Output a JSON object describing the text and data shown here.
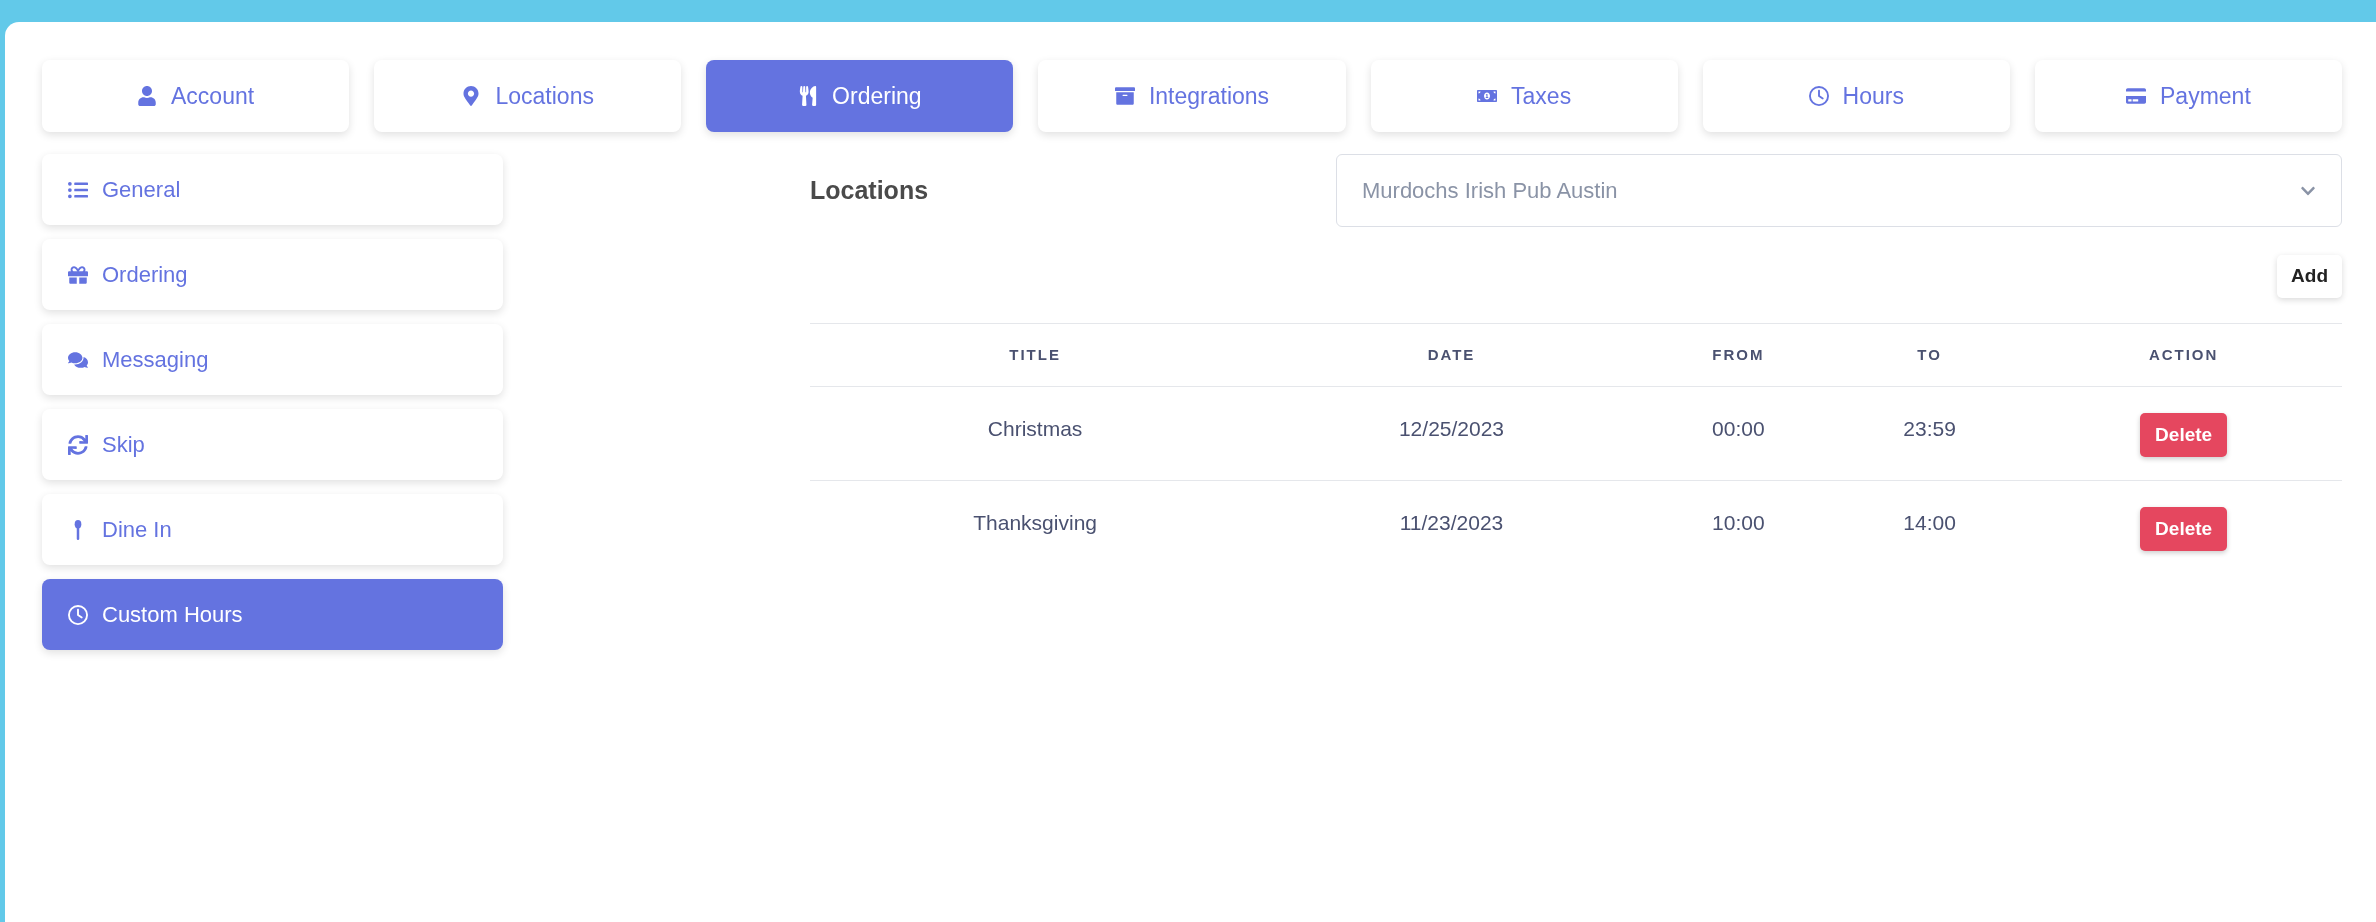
{
  "tabs": [
    {
      "label": "Account",
      "selected": false
    },
    {
      "label": "Locations",
      "selected": false
    },
    {
      "label": "Ordering",
      "selected": true
    },
    {
      "label": "Integrations",
      "selected": false
    },
    {
      "label": "Taxes",
      "selected": false
    },
    {
      "label": "Hours",
      "selected": false
    },
    {
      "label": "Payment",
      "selected": false
    }
  ],
  "sidebar": {
    "items": [
      {
        "label": "General",
        "selected": false
      },
      {
        "label": "Ordering",
        "selected": false
      },
      {
        "label": "Messaging",
        "selected": false
      },
      {
        "label": "Skip",
        "selected": false
      },
      {
        "label": "Dine In",
        "selected": false
      },
      {
        "label": "Custom Hours",
        "selected": true
      }
    ]
  },
  "location_picker": {
    "label": "Locations",
    "value": "Murdochs Irish Pub Austin"
  },
  "add_button": "Add",
  "table": {
    "columns": [
      "TITLE",
      "DATE",
      "FROM",
      "TO",
      "ACTION"
    ],
    "rows": [
      {
        "title": "Christmas",
        "date": "12/25/2023",
        "from": "00:00",
        "to": "23:59",
        "action": "Delete"
      },
      {
        "title": "Thanksgiving",
        "date": "11/23/2023",
        "from": "10:00",
        "to": "14:00",
        "action": "Delete"
      }
    ]
  }
}
